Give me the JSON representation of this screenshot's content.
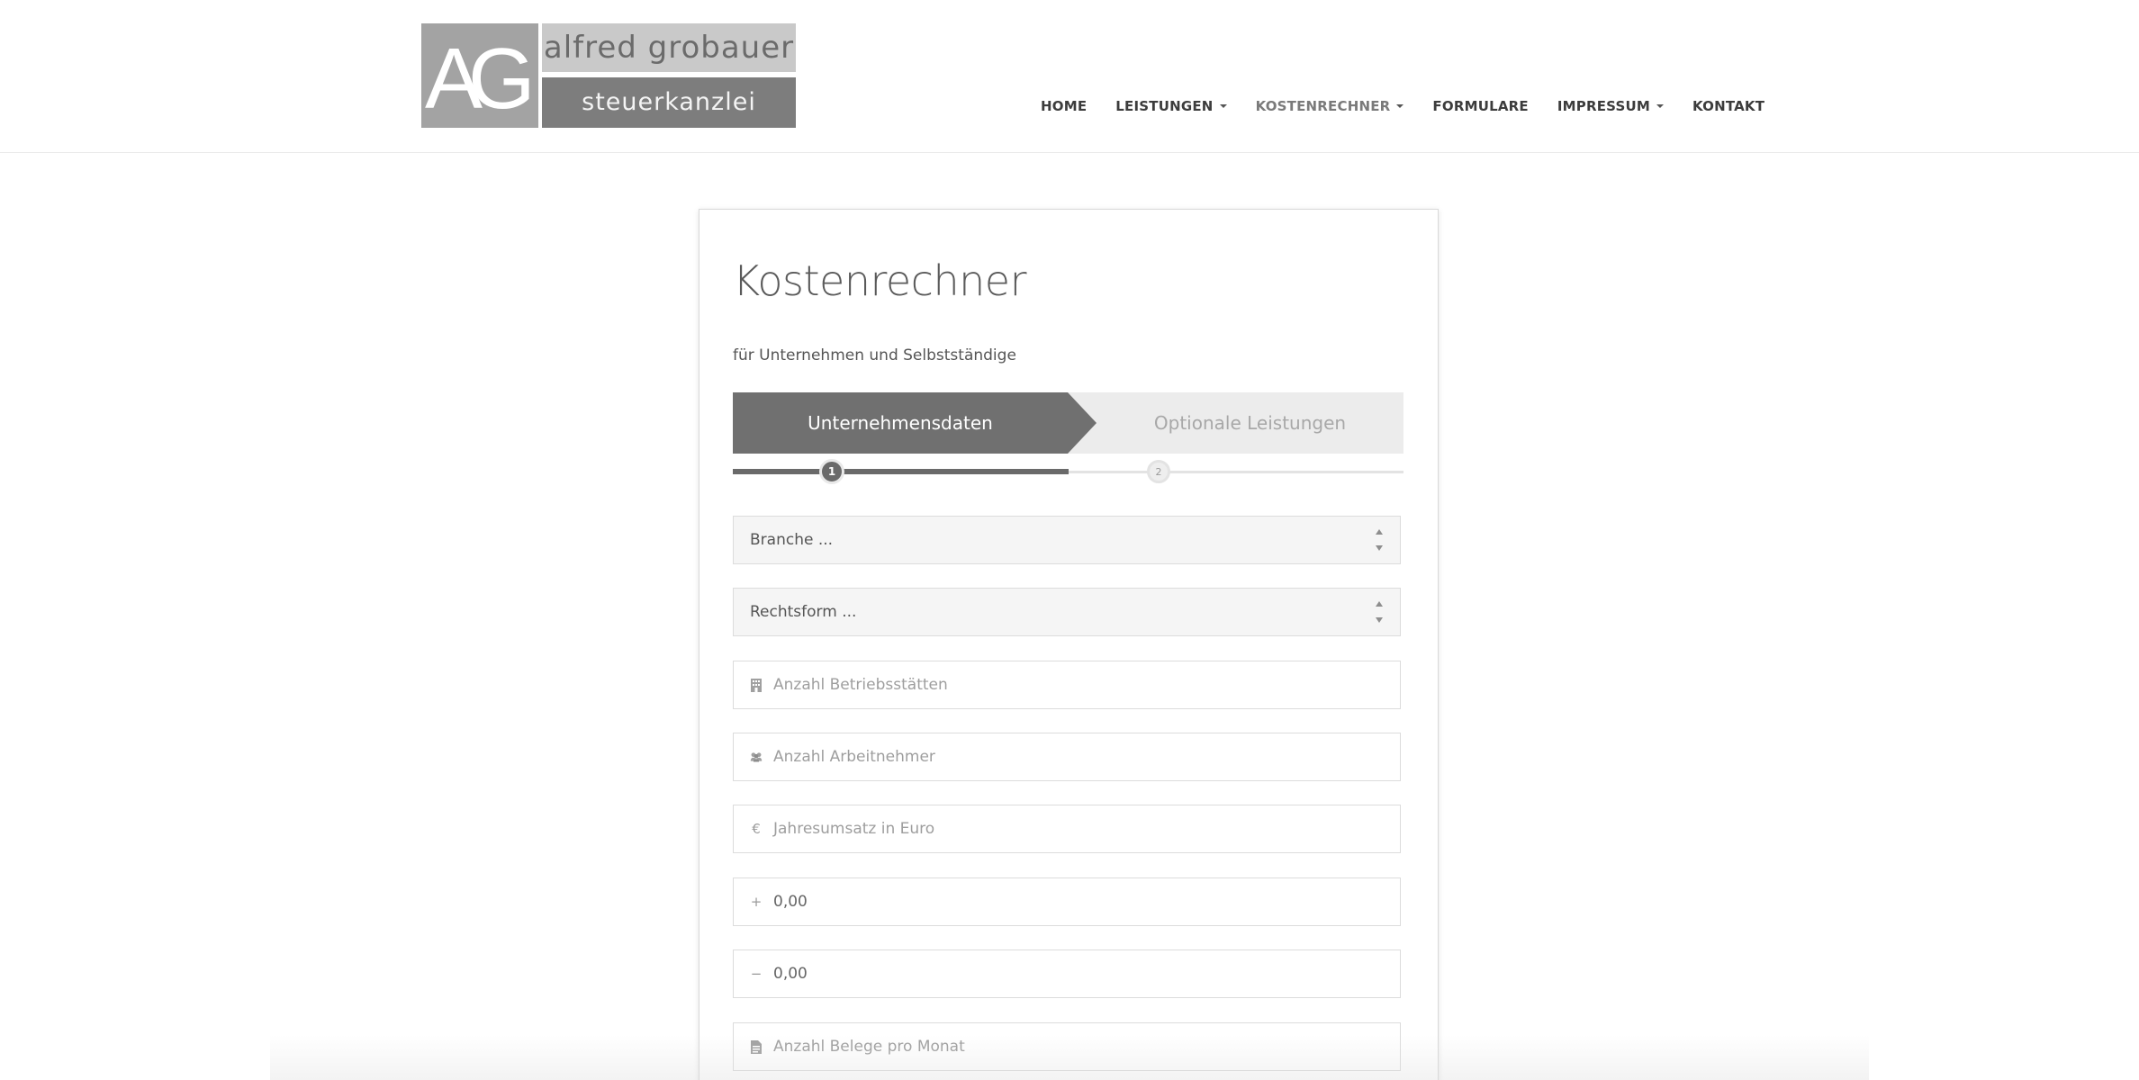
{
  "logo": {
    "monogram": "AG",
    "line1": "alfred grobauer",
    "line2": "steuerkanzlei"
  },
  "nav": {
    "items": [
      {
        "label": "HOME",
        "dropdown": false
      },
      {
        "label": "LEISTUNGEN",
        "dropdown": true
      },
      {
        "label": "KOSTENRECHNER",
        "dropdown": true,
        "active": true
      },
      {
        "label": "FORMULARE",
        "dropdown": false
      },
      {
        "label": "IMPRESSUM",
        "dropdown": true
      },
      {
        "label": "KONTAKT",
        "dropdown": false
      }
    ]
  },
  "card": {
    "title": "Kostenrechner",
    "subtitle": "für Unternehmen und Selbstständige",
    "steps": [
      {
        "label": "Unternehmensdaten",
        "number": "1",
        "active": true
      },
      {
        "label": "Optionale Leistungen",
        "number": "2",
        "active": false
      }
    ],
    "progress": 0.5,
    "fields": {
      "branche": {
        "placeholder": "Branche ..."
      },
      "rechtsform": {
        "placeholder": "Rechtsform ..."
      },
      "betriebsstaetten": {
        "placeholder": "Anzahl Betriebsstätten",
        "icon": "building-icon"
      },
      "arbeitnehmer": {
        "placeholder": "Anzahl Arbeitnehmer",
        "icon": "users-icon"
      },
      "jahresumsatz": {
        "placeholder": "Jahresumsatz in Euro",
        "icon": "euro-icon",
        "glyph": "€"
      },
      "plus": {
        "value": "0,00",
        "icon": "plus-icon",
        "glyph": "+"
      },
      "minus": {
        "value": "0,00",
        "icon": "minus-icon",
        "glyph": "−"
      },
      "belege": {
        "placeholder": "Anzahl Belege pro Monat",
        "icon": "document-icon"
      }
    }
  }
}
